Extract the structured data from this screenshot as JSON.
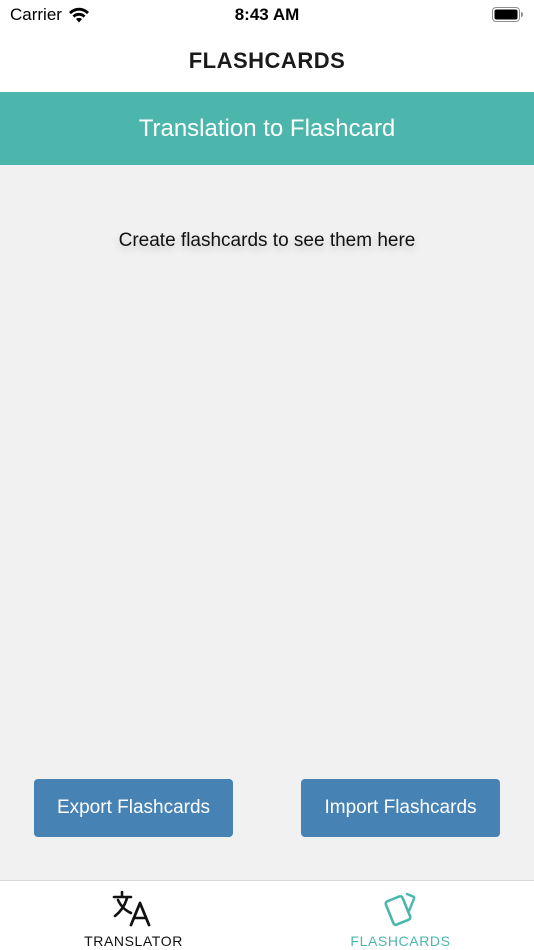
{
  "status_bar": {
    "carrier": "Carrier",
    "time": "8:43 AM",
    "icons": [
      "wifi-icon",
      "battery-icon"
    ]
  },
  "nav": {
    "title": "FLASHCARDS"
  },
  "banner": {
    "title": "Translation to Flashcard",
    "color": "#4db6ac"
  },
  "main": {
    "empty_message": "Create flashcards to see them here",
    "background": "#f1f1f1"
  },
  "actions": {
    "export_label": "Export Flashcards",
    "import_label": "Import Flashcards",
    "button_color": "#4682b4"
  },
  "tab_bar": {
    "tabs": [
      {
        "label": "TRANSLATOR",
        "icon": "translate-icon",
        "active": false
      },
      {
        "label": "FLASHCARDS",
        "icon": "flashcards-icon",
        "active": true
      }
    ],
    "active_color": "#4db6ac"
  }
}
